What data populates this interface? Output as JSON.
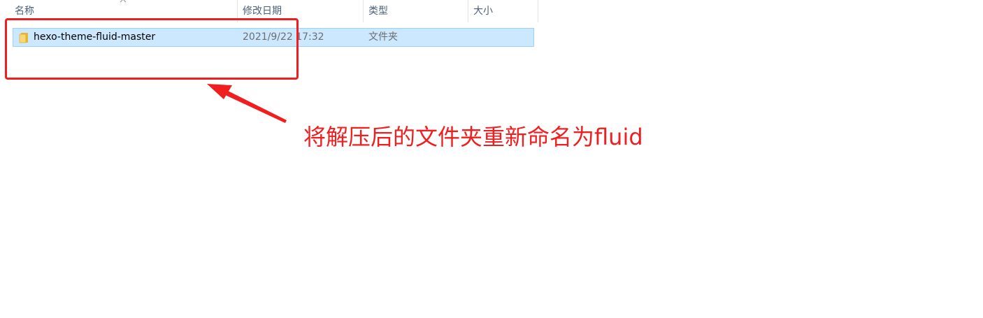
{
  "columns": {
    "name": "名称",
    "date_modified": "修改日期",
    "type": "类型",
    "size": "大小"
  },
  "files": [
    {
      "name": "hexo-theme-fluid-master",
      "date_modified": "2021/9/22 17:32",
      "type": "文件夹",
      "size": "",
      "icon": "folder-icon",
      "selected": true
    }
  ],
  "annotation": {
    "text": "将解压后的文件夹重新命名为fluid",
    "color": "#f01e1e"
  },
  "colors": {
    "selection_bg": "#cce8ff",
    "selection_border": "#99d1ff",
    "header_text": "#4c607a",
    "highlight": "#f01e1e"
  }
}
